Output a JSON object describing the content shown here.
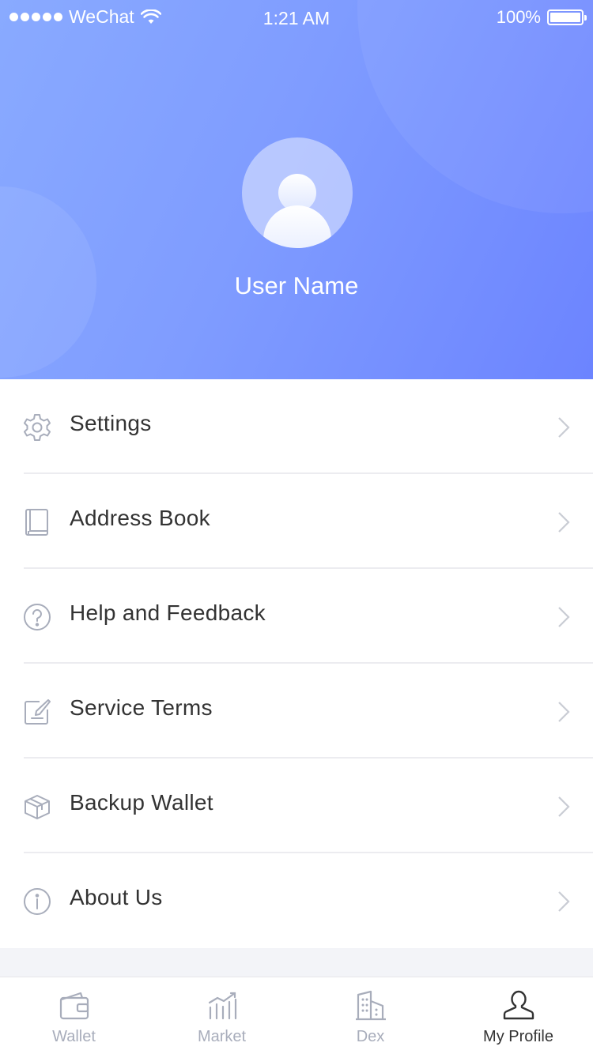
{
  "status_bar": {
    "carrier": "WeChat",
    "time": "1:21 AM",
    "battery": "100%"
  },
  "profile": {
    "user_name": "User Name"
  },
  "menu": {
    "items": [
      {
        "label": "Settings",
        "icon": "gear-icon"
      },
      {
        "label": "Address Book",
        "icon": "book-icon"
      },
      {
        "label": "Help and Feedback",
        "icon": "question-circle-icon"
      },
      {
        "label": "Service Terms",
        "icon": "edit-document-icon"
      },
      {
        "label": "Backup Wallet",
        "icon": "backup-box-icon"
      },
      {
        "label": "About Us",
        "icon": "info-circle-icon"
      }
    ]
  },
  "tabbar": {
    "tabs": [
      {
        "label": "Wallet",
        "icon": "wallet-icon",
        "active": false
      },
      {
        "label": "Market",
        "icon": "chart-bars-icon",
        "active": false
      },
      {
        "label": "Dex",
        "icon": "building-icon",
        "active": false
      },
      {
        "label": "My Profile",
        "icon": "person-icon",
        "active": true
      }
    ]
  },
  "colors": {
    "header_gradient_start": "#89aaff",
    "header_gradient_end": "#6c84ff",
    "icon_gray": "#a8adbb",
    "text_dark": "#333333",
    "active_tab": "#333333"
  }
}
